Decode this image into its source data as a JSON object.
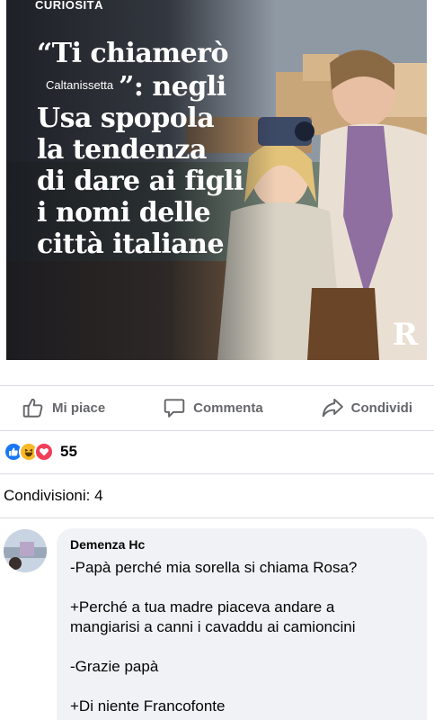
{
  "post": {
    "image": {
      "category": "CURIOSITÀ",
      "headline": {
        "line1": "“Ti chiamerò",
        "city": "Caltanissetta",
        "line2_rest": "”: negli",
        "line3": "Usa spopola",
        "line4": "la tendenza",
        "line5": "di dare ai figli",
        "line6": "i nomi delle",
        "line7": "città italiane"
      },
      "brand_logo": "R"
    },
    "actions": {
      "like": "Mi piace",
      "comment": "Commenta",
      "share": "Condividi"
    },
    "reactions": {
      "types": [
        "like",
        "haha",
        "love"
      ],
      "count": "55"
    },
    "shares": "Condivisioni: 4"
  },
  "comment": {
    "author": "Demenza Hc",
    "lines": [
      "-Papà perché mia sorella si chiama Rosa?",
      "+Perché a tua madre piaceva andare a",
      "mangiarisi a canni i cavaddu ai camioncini",
      "-Grazie papà",
      "+Di niente Francofonte"
    ]
  },
  "colors": {
    "action_text": "#65676b",
    "like_blue": "#1877f2",
    "haha_yellow": "#f7b928",
    "love_red": "#f33e58",
    "bubble_bg": "#f0f2f5",
    "divider": "#dadde1"
  }
}
